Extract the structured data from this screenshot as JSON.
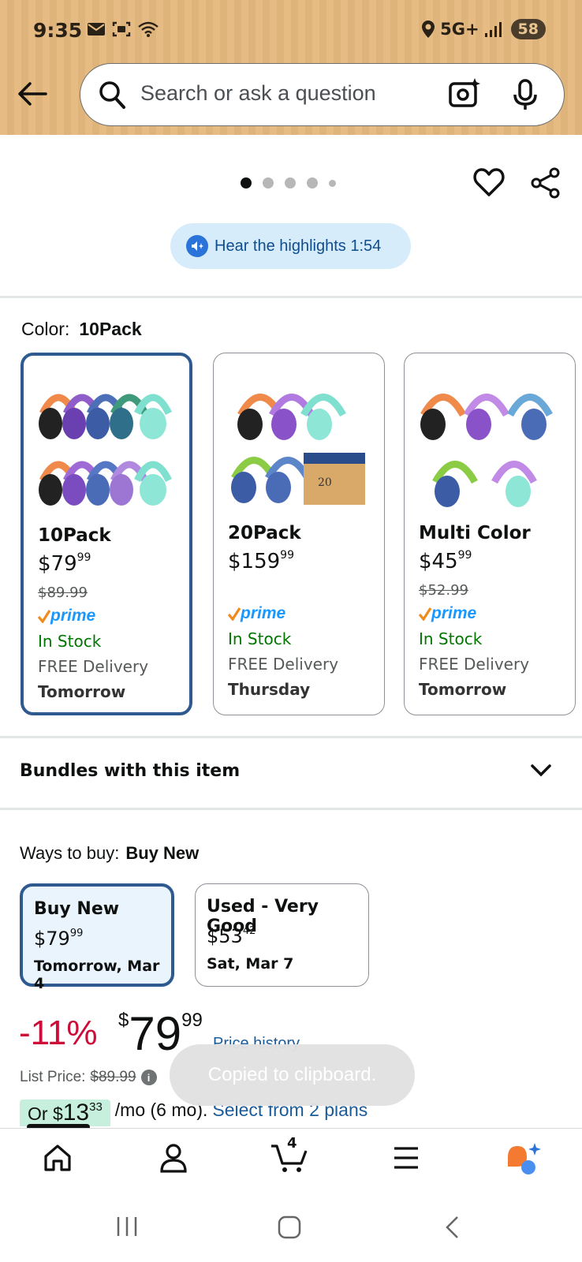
{
  "status_bar": {
    "time": "9:35",
    "network": "5G+",
    "battery": "58"
  },
  "search": {
    "placeholder": "Search or ask a question"
  },
  "gallery": {
    "dot_count": 5,
    "active_index": 0,
    "highlights_label": "Hear the highlights 1:54"
  },
  "color": {
    "label": "Color:",
    "selected": "10Pack",
    "variants": [
      {
        "name": "10Pack",
        "dollars": "$79",
        "cents": "99",
        "list_price": "$89.99",
        "prime": "prime",
        "stock": "In Stock",
        "delivery": "FREE Delivery",
        "day": "Tomorrow",
        "selected": true
      },
      {
        "name": "20Pack",
        "dollars": "$159",
        "cents": "99",
        "list_price": "",
        "prime": "prime",
        "stock": "In Stock",
        "delivery": "FREE Delivery",
        "day": "Thursday",
        "selected": false
      },
      {
        "name": "Multi Color",
        "dollars": "$45",
        "cents": "99",
        "list_price": "$52.99",
        "prime": "prime",
        "stock": "In Stock",
        "delivery": "FREE Delivery",
        "day": "Tomorrow",
        "selected": false
      }
    ]
  },
  "bundles": {
    "title": "Bundles with this item"
  },
  "ways_to_buy": {
    "label": "Ways to buy:",
    "selected": "Buy New",
    "options": [
      {
        "name": "Buy New",
        "dollars": "$79",
        "cents": "99",
        "date": "Tomorrow, Mar 4"
      },
      {
        "name": "Used - Very Good",
        "dollars": "$53",
        "cents": "42",
        "date": "Sat, Mar 7"
      }
    ]
  },
  "price": {
    "discount": "-11%",
    "currency": "$",
    "dollars": "79",
    "cents": "99",
    "history_link": "Price history",
    "list_price_label": "List Price:",
    "list_price_value": "$89.99",
    "info_glyph": "i",
    "monthly_prefix": "Or $",
    "monthly_dollars": "13",
    "monthly_cents": "33",
    "monthly_suffix": "/mo (6 mo).",
    "plans_link": "Select from 2 plans"
  },
  "toast": {
    "message": "Copied to clipboard."
  },
  "bottom_nav": {
    "cart_count": "4",
    "items": [
      "home-icon",
      "account-icon",
      "cart-icon",
      "menu-icon",
      "rufus-icon"
    ]
  },
  "colors": {
    "header_bg": "#e6bc84",
    "selected_border": "#2f5a90",
    "prime_blue": "#1a98ff",
    "in_stock_green": "#007600",
    "discount_red": "#cc0c39",
    "link_blue": "#1a5b9a"
  }
}
